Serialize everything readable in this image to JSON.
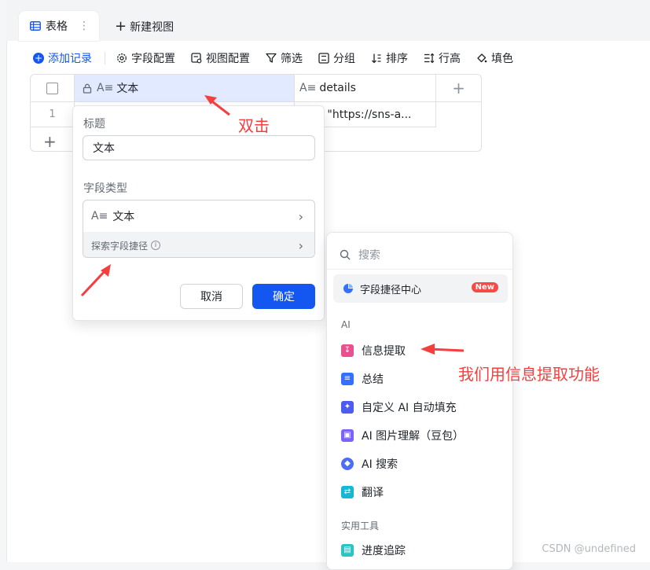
{
  "tabs": {
    "active_label": "表格",
    "more_glyph": "⋮",
    "new_view_label": "新建视图"
  },
  "toolbar": {
    "add_record": "添加记录",
    "field_config": "字段配置",
    "view_config": "视图配置",
    "filter": "筛选",
    "group": "分组",
    "sort": "排序",
    "row_height": "行高",
    "fill_color": "填色"
  },
  "grid": {
    "columns": [
      {
        "name": "文本",
        "icon": "text-field-icon",
        "locked": true
      },
      {
        "name": "details",
        "icon": "text-field-icon"
      }
    ],
    "rows": [
      {
        "index": "1",
        "details": "tar\": \"https://sns-a..."
      }
    ]
  },
  "field_editor": {
    "title_label": "标题",
    "title_value": "文本",
    "type_label": "字段类型",
    "type_value": "文本",
    "explore_label": "探索字段捷径",
    "cancel_label": "取消",
    "confirm_label": "确定"
  },
  "shortcut_menu": {
    "search_placeholder": "搜索",
    "hub_label": "字段捷径中心",
    "hub_badge": "New",
    "section_ai": "AI",
    "ai_items": [
      {
        "label": "信息提取",
        "icon": "info-extract-icon",
        "color": "#e8508f"
      },
      {
        "label": "总结",
        "icon": "summary-icon",
        "color": "#3370ff"
      },
      {
        "label": "自定义 AI 自动填充",
        "icon": "ai-autofill-icon",
        "color": "#4e5bf2"
      },
      {
        "label": "AI 图片理解（豆包）",
        "icon": "image-understanding-icon",
        "color": "#7b61ff"
      },
      {
        "label": "AI 搜索",
        "icon": "ai-search-icon",
        "color": "#4c6ef5"
      },
      {
        "label": "翻译",
        "icon": "translate-icon",
        "color": "#14b8d6"
      }
    ],
    "section_tools": "实用工具",
    "tool_items": [
      {
        "label": "进度追踪",
        "icon": "progress-track-icon",
        "color": "#2bc4c4"
      }
    ]
  },
  "annotations": {
    "double_click": "双击",
    "use_feature": "我们用信息提取功能"
  },
  "watermark": "CSDN @undefined",
  "colors": {
    "accent": "#1456f0",
    "annotation": "#f53f3f"
  }
}
